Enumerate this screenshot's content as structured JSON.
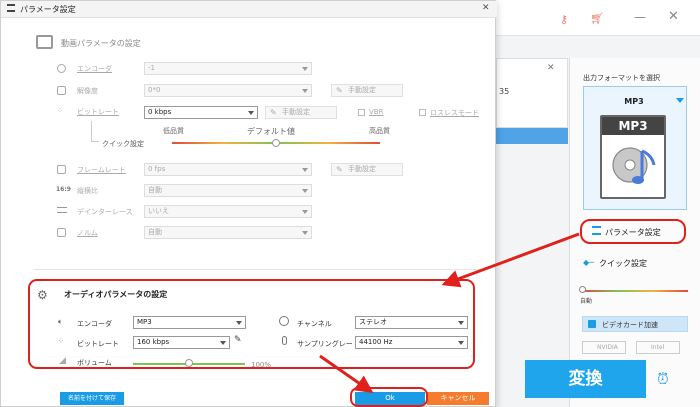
{
  "dialog": {
    "title": "パラメータ設定",
    "video_section_title": "動画パラメータの設定",
    "audio_section_title": "オーディオパラメータの設定",
    "video": {
      "encoder": {
        "label": "エンコーダ",
        "value": "-1"
      },
      "resolution": {
        "label": "解像度",
        "value": "0*0",
        "button": "手動設定"
      },
      "bitrate": {
        "label": "ビットレート",
        "value": "0 kbps",
        "button": "手動設定",
        "vbr": "VBR",
        "lossless": "ロスレスモード"
      },
      "quick": {
        "label": "クイック設定",
        "low": "低品質",
        "default": "デフォルト値",
        "high": "高品質"
      },
      "framerate": {
        "label": "フレームレート",
        "value": "0 fps",
        "button": "手動設定"
      },
      "aspect": {
        "label": "縦横比",
        "value": "自動"
      },
      "deinterlace": {
        "label": "デインターレース",
        "value": "いいえ"
      },
      "zoom": {
        "label": "ノルム",
        "value": "自動"
      }
    },
    "audio": {
      "encoder": {
        "label": "エンコーダ",
        "value": "MP3"
      },
      "channel": {
        "label": "チャンネル",
        "value": "ステレオ"
      },
      "bitrate": {
        "label": "ビットレート",
        "value": "160 kbps"
      },
      "samplerate": {
        "label": "サンプリングレート",
        "value": "44100 Hz"
      },
      "volume": {
        "label": "ボリューム",
        "value": "100%"
      }
    },
    "save_as": "名前を付けて保存",
    "ok": "Ok",
    "cancel": "キャンセル"
  },
  "right_panel": {
    "heading": "出力フォーマットを選択",
    "format": "MP3",
    "param_button": "パラメータ設定",
    "quick_setting": "クイック設定",
    "auto": "自動",
    "gpu_accel": "ビデオカード加速",
    "nvidia": "NVIDIA",
    "intel": "Intel",
    "convert": "変換"
  },
  "file_panel": {
    "number": "35"
  },
  "colors": {
    "accent": "#1a9be6",
    "highlight": "#e0201b",
    "cancel": "#f57c2c"
  }
}
